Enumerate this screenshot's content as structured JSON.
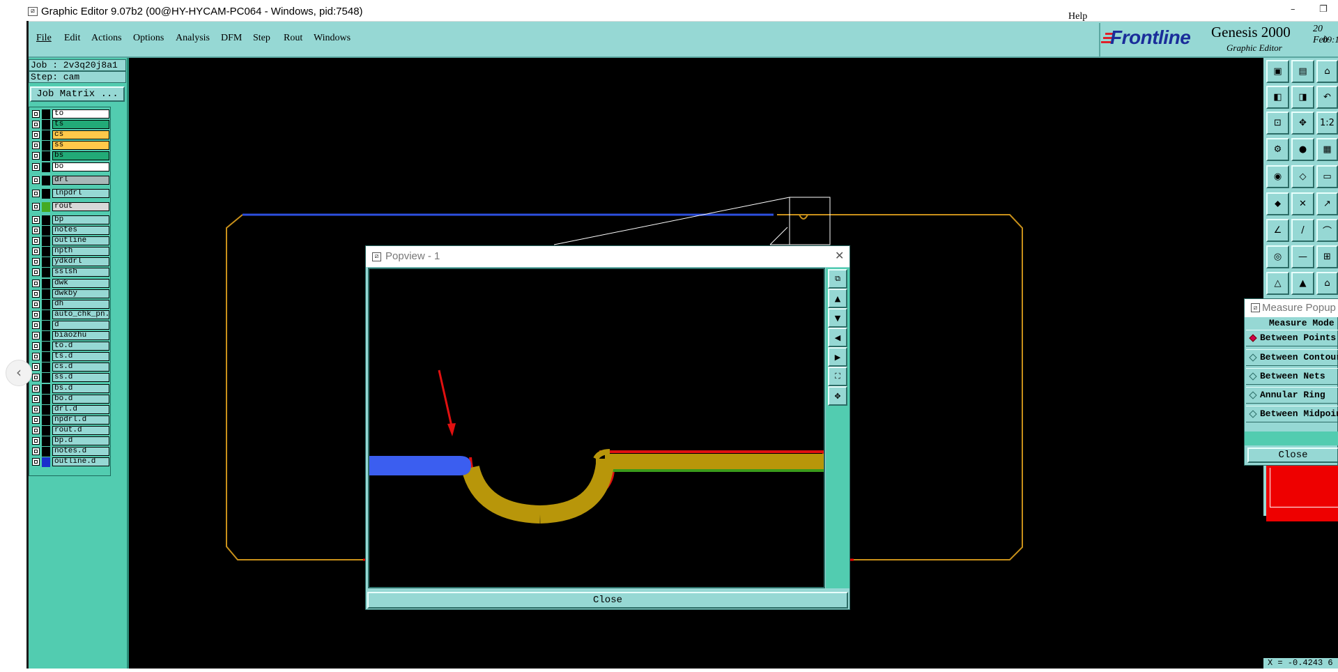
{
  "window": {
    "title": "Graphic Editor 9.07b2 (00@HY-HYCAM-PC064 - Windows, pid:7548)",
    "minimize": "–",
    "restore": "❐"
  },
  "menu": {
    "items": [
      "File",
      "Edit",
      "Actions",
      "Options",
      "Analysis",
      "DFM",
      "Step",
      "Rout",
      "Windows"
    ],
    "help": "Help"
  },
  "brand": {
    "logo": "Frontline",
    "product": "Genesis 2000",
    "subtitle": "Graphic Editor",
    "date": "20 Feb",
    "time": "09:1("
  },
  "job": {
    "job_label": "Job : 2v3q20j8a1",
    "step_label": "Step: cam",
    "matrix_button": "Job Matrix ..."
  },
  "layers": [
    {
      "name": "to",
      "color": "#ffffff",
      "swatch": "#000000"
    },
    {
      "name": "ts",
      "color": "#22aa77",
      "swatch": "#000000"
    },
    {
      "name": "cs",
      "color": "#ffc84a",
      "swatch": "#000000"
    },
    {
      "name": "ss",
      "color": "#ffc84a",
      "swatch": "#000000"
    },
    {
      "name": "bs",
      "color": "#22aa77",
      "swatch": "#000000"
    },
    {
      "name": "bo",
      "color": "#ffffff",
      "swatch": "#000000"
    },
    {
      "name": "drl",
      "color": "#a7b8b8",
      "swatch": "#000000"
    },
    {
      "name": "lnpdrl",
      "color": "#96d8d4",
      "swatch": "#000000"
    },
    {
      "name": "rout",
      "color": "#d8d8d8",
      "swatch": "#44aa22"
    },
    {
      "name": "bp",
      "color": "#96d8d4",
      "swatch": "#000000"
    },
    {
      "name": "notes",
      "color": "#96d8d4",
      "swatch": "#000000"
    },
    {
      "name": "outline",
      "color": "#96d8d4",
      "swatch": "#000000"
    },
    {
      "name": "npth",
      "color": "#96d8d4",
      "swatch": "#000000"
    },
    {
      "name": "ydkdrl",
      "color": "#96d8d4",
      "swatch": "#000000"
    },
    {
      "name": "sslsh",
      "color": "#96d8d4",
      "swatch": "#000000"
    },
    {
      "name": "dwk",
      "color": "#96d8d4",
      "swatch": "#000000"
    },
    {
      "name": "dwkby",
      "color": "#96d8d4",
      "swatch": "#000000"
    },
    {
      "name": "dh",
      "color": "#96d8d4",
      "swatch": "#000000"
    },
    {
      "name": "auto_chk_pn.",
      "color": "#96d8d4",
      "swatch": "#000000"
    },
    {
      "name": "d",
      "color": "#96d8d4",
      "swatch": "#000000"
    },
    {
      "name": "biaozhu",
      "color": "#96d8d4",
      "swatch": "#000000"
    },
    {
      "name": "to.d",
      "color": "#96d8d4",
      "swatch": "#000000"
    },
    {
      "name": "ts.d",
      "color": "#96d8d4",
      "swatch": "#000000"
    },
    {
      "name": "cs.d",
      "color": "#96d8d4",
      "swatch": "#000000"
    },
    {
      "name": "ss.d",
      "color": "#96d8d4",
      "swatch": "#000000"
    },
    {
      "name": "bs.d",
      "color": "#96d8d4",
      "swatch": "#000000"
    },
    {
      "name": "bo.d",
      "color": "#96d8d4",
      "swatch": "#000000"
    },
    {
      "name": "drl.d",
      "color": "#96d8d4",
      "swatch": "#000000"
    },
    {
      "name": "npdrl.d",
      "color": "#96d8d4",
      "swatch": "#000000"
    },
    {
      "name": "rout.d",
      "color": "#96d8d4",
      "swatch": "#000000"
    },
    {
      "name": "bp.d",
      "color": "#96d8d4",
      "swatch": "#000000"
    },
    {
      "name": "notes.d",
      "color": "#96d8d4",
      "swatch": "#000000"
    },
    {
      "name": "outline.d",
      "color": "#96d8d4",
      "swatch": "#1a2dcc"
    }
  ],
  "popview": {
    "title": "Popview - 1",
    "close_x": "✕",
    "close_button": "Close"
  },
  "measure": {
    "title": "Measure Popup",
    "mode_header": "Measure Mode",
    "options": [
      "Between Points",
      "Between Contours",
      "Between Nets",
      "Annular Ring",
      "Between Midpoints"
    ],
    "selected": 0,
    "close_button": "Close"
  },
  "status": {
    "coords": "X = -0.4243 6"
  },
  "toolbar_icons": [
    "open-icon",
    "save-icon",
    "home-icon",
    "zoom-in-icon",
    "zoom-out-icon",
    "undo-zoom-icon",
    "fit-icon",
    "center-icon",
    "one-to-one-icon",
    "settings-icon",
    "snap-icon",
    "layer-grid-icon",
    "select-icon",
    "shape-icon",
    "ruler-icon",
    "connect-icon",
    "delete-icon",
    "move-icon",
    "angle-icon",
    "line-icon",
    "arc-icon",
    "point-icon",
    "minus-icon",
    "array-icon",
    "triangle-icon",
    "fill-icon",
    "arch-icon"
  ]
}
